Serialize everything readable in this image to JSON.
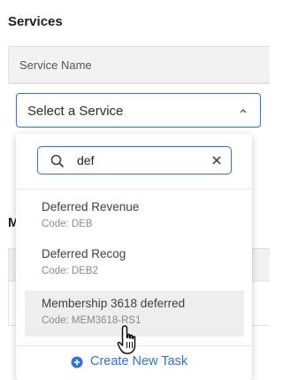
{
  "services": {
    "title": "Services",
    "column_header": "Service Name",
    "select_label": "Select a Service"
  },
  "background": {
    "section_letter": "M"
  },
  "dropdown": {
    "search_value": "def",
    "options": [
      {
        "name": "Deferred Revenue",
        "code": "Code: DEB"
      },
      {
        "name": "Deferred Recog",
        "code": "Code: DEB2"
      },
      {
        "name": "Membership 3618 deferred",
        "code": "Code: MEM3618-RS1"
      }
    ],
    "create_label": "Create New Task"
  },
  "colors": {
    "accent": "#2d72d9",
    "highlight": "#eeeeee"
  },
  "icons": {
    "search": "search-icon",
    "clear": "close-icon",
    "chevron": "chevron-up-icon",
    "add": "plus-circle-icon",
    "cursor": "hand-pointer-icon"
  }
}
